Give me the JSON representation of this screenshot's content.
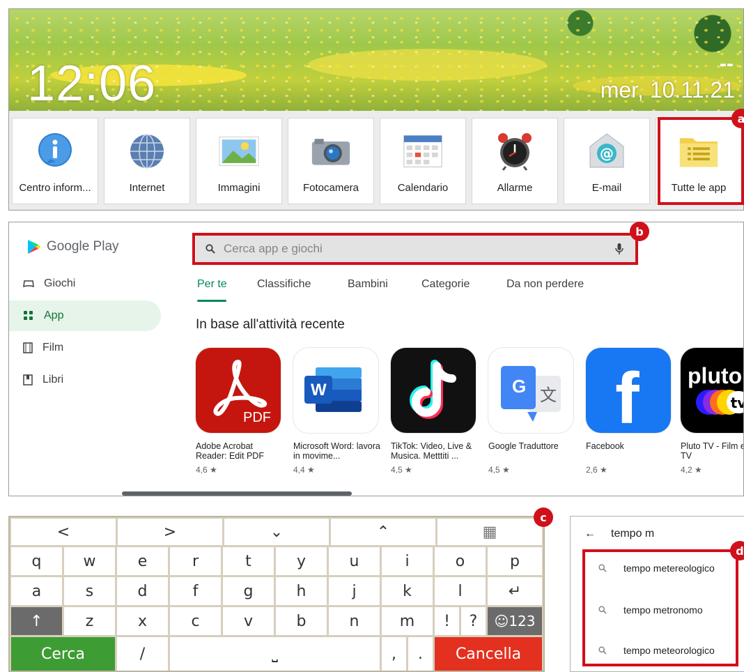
{
  "launcher": {
    "time": "12:06",
    "date": "mer, 10.11.21",
    "dash": "--",
    "tiles": [
      {
        "label": "Centro inform...",
        "icon": "info-icon"
      },
      {
        "label": "Internet",
        "icon": "globe-icon"
      },
      {
        "label": "Immagini",
        "icon": "image-icon"
      },
      {
        "label": "Fotocamera",
        "icon": "camera-icon"
      },
      {
        "label": "Calendario",
        "icon": "calendar-icon"
      },
      {
        "label": "Allarme",
        "icon": "alarm-clock-icon"
      },
      {
        "label": "E-mail",
        "icon": "email-icon"
      },
      {
        "label": "Tutte le app",
        "icon": "folder-icon"
      }
    ]
  },
  "markers": {
    "a": "a",
    "b": "b",
    "c": "c",
    "d": "d"
  },
  "play": {
    "brand": "Google Play",
    "nav": [
      {
        "label": "Giochi",
        "icon": "gamepad-icon"
      },
      {
        "label": "App",
        "icon": "apps-grid-icon"
      },
      {
        "label": "Film",
        "icon": "film-icon"
      },
      {
        "label": "Libri",
        "icon": "book-icon"
      }
    ],
    "search_placeholder": "Cerca app e giochi",
    "tabs": [
      "Per te",
      "Classifiche",
      "Bambini",
      "Categorie",
      "Da non perdere"
    ],
    "section_title": "In base all'attività recente",
    "apps": [
      {
        "name": "Adobe Acrobat Reader: Edit PDF",
        "rating": "4,6 ★",
        "icon": "adobe-acrobat-icon",
        "icon_text": "PDF"
      },
      {
        "name": "Microsoft Word: lavora in movime...",
        "rating": "4,4 ★",
        "icon": "microsoft-word-icon",
        "icon_text": "W"
      },
      {
        "name": "TikTok: Video, Live & Musica. Metttiti ...",
        "rating": "4,5 ★",
        "icon": "tiktok-icon",
        "icon_text": "♪"
      },
      {
        "name": "Google Traduttore",
        "rating": "4,5 ★",
        "icon": "google-translate-icon",
        "icon_text": "G"
      },
      {
        "name": "Facebook",
        "rating": "2,6 ★",
        "icon": "facebook-icon",
        "icon_text": "f"
      },
      {
        "name": "Pluto TV - Film e Serie TV",
        "rating": "4,2 ★",
        "icon": "pluto-tv-icon",
        "icon_text": "pluto"
      }
    ],
    "colors": {
      "accent": "#01875f",
      "marker": "#d0101b"
    }
  },
  "keyboard": {
    "nav_row": [
      "<",
      ">",
      "⌄",
      "⌃",
      "▦"
    ],
    "row1": [
      "q",
      "w",
      "e",
      "r",
      "t",
      "y",
      "u",
      "i",
      "o",
      "p"
    ],
    "row2": [
      "a",
      "s",
      "d",
      "f",
      "g",
      "h",
      "j",
      "k",
      "l",
      "↵"
    ],
    "row3": [
      "↑",
      "z",
      "x",
      "c",
      "v",
      "b",
      "n",
      "m",
      "!",
      "?",
      "☺123"
    ],
    "search_key": "Cerca",
    "slash_key": "/",
    "space_key": "⎵",
    "comma_key": ",",
    "period_key": ".",
    "delete_key": "Cancella"
  },
  "suggest": {
    "back_icon": "←",
    "query": "tempo m",
    "items": [
      "tempo metereologico",
      "tempo metronomo",
      "tempo meteorologico"
    ]
  }
}
